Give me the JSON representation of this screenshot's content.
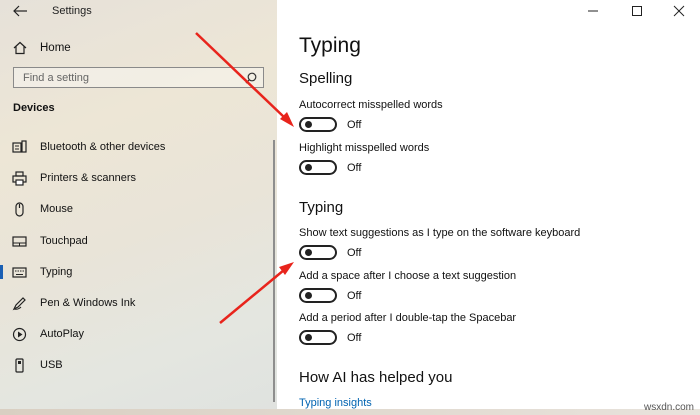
{
  "app": {
    "title": "Settings"
  },
  "sidebar": {
    "home_label": "Home",
    "search_placeholder": "Find a setting",
    "section_heading": "Devices",
    "items": [
      {
        "label": "Bluetooth & other devices",
        "icon": "bluetooth-devices-icon"
      },
      {
        "label": "Printers & scanners",
        "icon": "printer-icon"
      },
      {
        "label": "Mouse",
        "icon": "mouse-icon"
      },
      {
        "label": "Touchpad",
        "icon": "touchpad-icon"
      },
      {
        "label": "Typing",
        "icon": "keyboard-icon",
        "selected": true
      },
      {
        "label": "Pen & Windows Ink",
        "icon": "pen-icon"
      },
      {
        "label": "AutoPlay",
        "icon": "autoplay-icon"
      },
      {
        "label": "USB",
        "icon": "usb-icon"
      }
    ]
  },
  "main": {
    "title": "Typing",
    "spelling": {
      "heading": "Spelling",
      "options": [
        {
          "label": "Autocorrect misspelled words",
          "state": "Off"
        },
        {
          "label": "Highlight misspelled words",
          "state": "Off"
        }
      ]
    },
    "typing": {
      "heading": "Typing",
      "options": [
        {
          "label": "Show text suggestions as I type on the software keyboard",
          "state": "Off"
        },
        {
          "label": "Add a space after I choose a text suggestion",
          "state": "Off"
        },
        {
          "label": "Add a period after I double-tap the Spacebar",
          "state": "Off"
        }
      ]
    },
    "ai": {
      "heading": "How AI has helped you",
      "link": "Typing insights"
    }
  },
  "watermark": "wsxdn.com",
  "colors": {
    "accent": "#1a5fb4",
    "link": "#0063b1",
    "annotation_arrow": "#e8241c"
  }
}
